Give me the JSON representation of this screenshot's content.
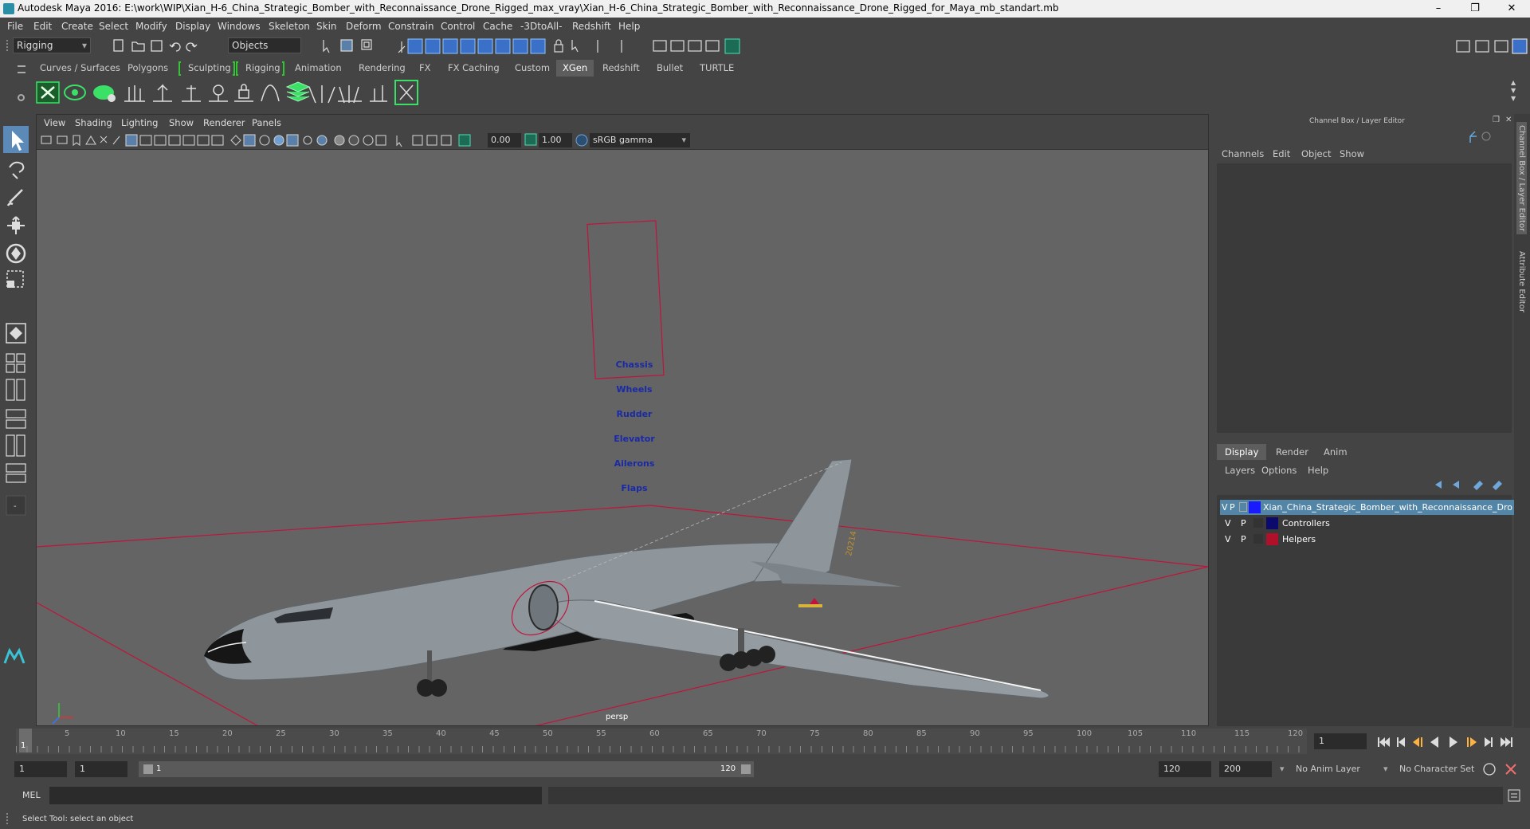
{
  "window": {
    "title": "Autodesk Maya 2016: E:\\work\\WIP\\Xian_H-6_China_Strategic_Bomber_with_Reconnaissance_Drone_Rigged_max_vray\\Xian_H-6_China_Strategic_Bomber_with_Reconnaissance_Drone_Rigged_for_Maya_mb_standart.mb",
    "minimize": "–",
    "restore": "❐",
    "close": "✕"
  },
  "menubar": [
    "File",
    "Edit",
    "Create",
    "Select",
    "Modify",
    "Display",
    "Windows",
    "Skeleton",
    "Skin",
    "Deform",
    "Constrain",
    "Control",
    "Cache",
    "-3DtoAll-",
    "Redshift",
    "Help"
  ],
  "statusline": {
    "mode": "Rigging",
    "selection_mode": "Objects"
  },
  "shelf": {
    "tabs": [
      "Curves / Surfaces",
      "Polygons",
      "Sculpting",
      "Rigging",
      "Animation",
      "Rendering",
      "FX",
      "FX Caching",
      "Custom",
      "XGen",
      "Redshift",
      "Bullet",
      "TURTLE"
    ],
    "active_tab": "XGen"
  },
  "viewport": {
    "menu": [
      "View",
      "Shading",
      "Lighting",
      "Show",
      "Renderer",
      "Panels"
    ],
    "exposure": "0.00",
    "gamma": "1.00",
    "colorspace": "sRGB gamma",
    "camera_label": "persp",
    "controls_panel": [
      "Chassis",
      "Wheels",
      "Rudder",
      "Elevator",
      "Ailerons",
      "Flaps"
    ],
    "tail_number": "20214"
  },
  "channelbox": {
    "title": "Channel Box / Layer Editor",
    "menu": [
      "Channels",
      "Edit",
      "Object",
      "Show"
    ]
  },
  "layer_editor": {
    "tabs": [
      "Display",
      "Render",
      "Anim"
    ],
    "active_tab": "Display",
    "menu": [
      "Layers",
      "Options",
      "Help"
    ],
    "layers": [
      {
        "v": "V",
        "p": "P",
        "name": "Xian_China_Strategic_Bomber_with_Reconnaissance_Dro",
        "color": "#1a1aff",
        "selected": true
      },
      {
        "v": "V",
        "p": "P",
        "name": "Controllers",
        "color": "#0b0b6e",
        "selected": false
      },
      {
        "v": "V",
        "p": "P",
        "name": "Helpers",
        "color": "#b0102a",
        "selected": false
      }
    ]
  },
  "side_tabs": [
    "Channel Box / Layer Editor",
    "Attribute Editor"
  ],
  "timeline": {
    "current_frame": "1",
    "ticks": [
      "1",
      "5",
      "10",
      "15",
      "20",
      "25",
      "30",
      "35",
      "40",
      "45",
      "50",
      "55",
      "60",
      "65",
      "70",
      "75",
      "80",
      "85",
      "90",
      "95",
      "100",
      "105",
      "110",
      "115",
      "120"
    ],
    "frame_field": "1"
  },
  "range": {
    "start": "1",
    "playback_start": "1",
    "range_start_label": "1",
    "range_end_label": "120",
    "playback_end": "120",
    "end": "200",
    "anim_layer": "No Anim Layer",
    "character_set": "No Character Set"
  },
  "cmdline": {
    "lang": "MEL"
  },
  "helpline": {
    "text": "Select Tool: select an object"
  },
  "colors": {
    "accent": "#4fb6ff",
    "shelf_green": "#33c433",
    "grid_red": "#c0143c"
  }
}
